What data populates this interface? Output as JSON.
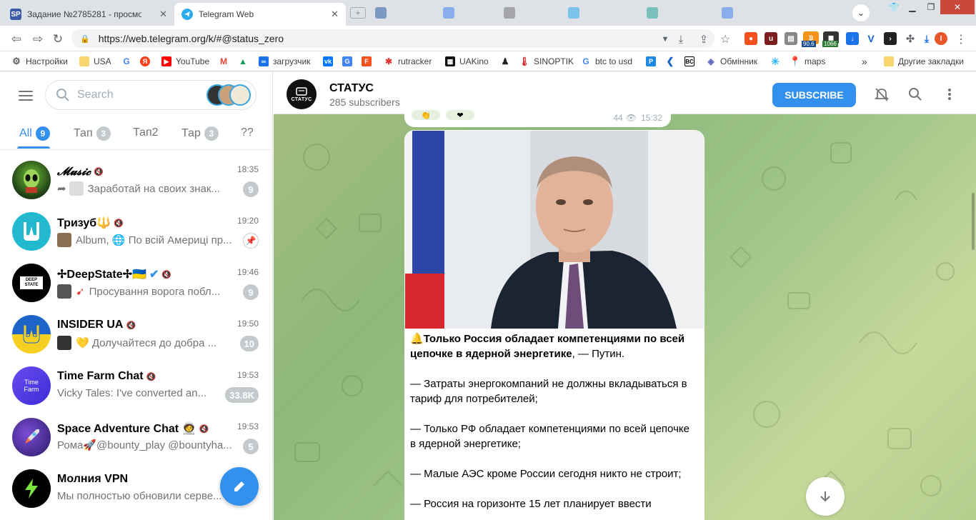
{
  "browser": {
    "tabs": [
      {
        "title": "Задание №2785281 - просмотр з",
        "favicon": "SP"
      },
      {
        "title": "Telegram Web",
        "favicon": "telegram-icon"
      }
    ],
    "url": "https://web.telegram.org/k/#@status_zero",
    "extension_badges": {
      "badge1": "90.6",
      "badge2": "1066"
    },
    "bookmarks": [
      {
        "label": "Настройки",
        "icon": "gear-icon"
      },
      {
        "label": "USA",
        "icon": "folder-icon"
      },
      {
        "label": "",
        "icon": "google-icon"
      },
      {
        "label": "",
        "icon": "yandex-icon"
      },
      {
        "label": "YouTube",
        "icon": "youtube-icon"
      },
      {
        "label": "",
        "icon": "gmail-icon"
      },
      {
        "label": "",
        "icon": "drive-icon"
      },
      {
        "label": "загрузчик",
        "icon": "infinity-icon"
      },
      {
        "label": "",
        "icon": "vk-icon"
      },
      {
        "label": "",
        "icon": "translate-icon"
      },
      {
        "label": "",
        "icon": "f-icon"
      },
      {
        "label": "rutracker",
        "icon": "rutracker-icon"
      },
      {
        "label": "UAKino",
        "icon": "uakino-icon"
      },
      {
        "label": "",
        "icon": "figure-icon"
      },
      {
        "label": "SINOPTIK",
        "icon": "thermometer-icon"
      },
      {
        "label": "btc to usd",
        "icon": "google-icon"
      },
      {
        "label": "",
        "icon": "p-icon"
      },
      {
        "label": "",
        "icon": "arrow-icon"
      },
      {
        "label": "",
        "icon": "bc-icon"
      },
      {
        "label": "Обмінник",
        "icon": "exchange-icon"
      },
      {
        "label": "",
        "icon": "star-icon"
      },
      {
        "label": "maps",
        "icon": "maps-icon"
      }
    ],
    "bookmarks_more": "»",
    "other_bookmarks": "Другие закладки"
  },
  "sidebar": {
    "search_placeholder": "Search",
    "folders": [
      {
        "label": "All",
        "count": "9"
      },
      {
        "label": "Тап",
        "count": "3"
      },
      {
        "label": "Тап2",
        "count": ""
      },
      {
        "label": "Тар",
        "count": "3"
      },
      {
        "label": "??",
        "count": ""
      }
    ],
    "chats": [
      {
        "name": "𝓜𝓾𝓼𝓲𝓬",
        "time": "18:35",
        "preview": "Заработай на своих знак...",
        "badge": "9",
        "muted": true,
        "forwarded": true
      },
      {
        "name": "Тризуб🔱",
        "time": "19:20",
        "preview": "Album, 🌐 По всій Америці пр...",
        "badge": "",
        "muted": true,
        "pinned": true
      },
      {
        "name": "✢DeepState✢🇺🇦",
        "time": "19:46",
        "preview": "Просування ворога побл...",
        "badge": "9",
        "muted": true,
        "verified": true
      },
      {
        "name": "INSIDER UA",
        "time": "19:50",
        "preview": "💛 Долучайтеся до добра ...",
        "badge": "10",
        "muted": true
      },
      {
        "name": "Time Farm Chat",
        "time": "19:53",
        "preview": "Vicky Tales: I've converted an...",
        "badge": "33.8K",
        "muted": true
      },
      {
        "name": "Space Adventure Chat 🧑‍🚀",
        "time": "19:53",
        "preview": "Рома🚀@bounty_play @bountyha...",
        "badge": "5",
        "muted": true
      },
      {
        "name": "Молния VPN",
        "time": "",
        "preview": "Мы полностью обновили серве...",
        "badge": "",
        "muted": false
      }
    ]
  },
  "channel": {
    "title": "СТАТУС",
    "avatar_label": "СТАТУС",
    "subscribers": "285 subscribers",
    "subscribe_label": "SUBSCRIBE",
    "prev_message": {
      "views": "44",
      "time": "15:32"
    },
    "post": {
      "headline_emoji": "🔔",
      "headline_bold": "Только Россия обладает компетенциями по всей цепочке в ядерной энергетике",
      "headline_rest": ", — Путин.",
      "paragraphs": [
        "— Затраты энергокомпаний не должны вкладываться в тариф для потребителей;",
        "— Только РФ обладает компетенциями по всей цепочке в ядерной энергетике;",
        "— Малые АЭС кроме России сегодня никто не строит;",
        "— Россия на горизонте 15 лет планирует ввести"
      ]
    }
  },
  "colors": {
    "accent": "#3390ec",
    "badge_muted": "#c4c9cc",
    "text_secondary": "#707579"
  }
}
